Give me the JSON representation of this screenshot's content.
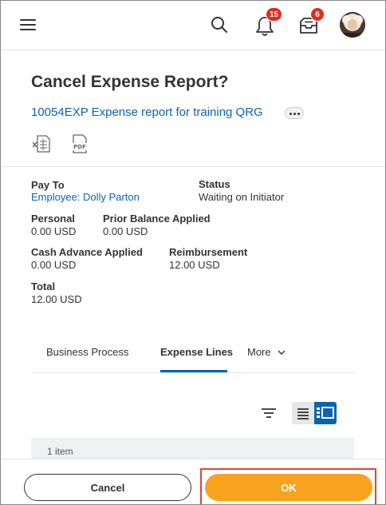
{
  "header": {
    "menu_icon": "hamburger-menu-icon",
    "search_icon": "search-icon",
    "notifications": {
      "icon": "bell-icon",
      "count": "15"
    },
    "inbox": {
      "icon": "inbox-icon",
      "count": "6"
    },
    "badge_color": "#de2e21"
  },
  "page": {
    "title": "Cancel Expense Report?",
    "report_link": "10054EXP Expense report for training QRG",
    "related_actions_icon": "ellipsis-icon",
    "export_excel_icon": "excel-export-icon",
    "export_pdf_icon": "pdf-export-icon"
  },
  "fields": {
    "pay_to": {
      "label": "Pay To",
      "value": "Employee: Dolly Parton"
    },
    "status": {
      "label": "Status",
      "value": "Waiting on Initiator"
    },
    "personal": {
      "label": "Personal",
      "value": "0.00 USD"
    },
    "prior_balance": {
      "label": "Prior Balance Applied",
      "value": "0.00 USD"
    },
    "cash_advance": {
      "label": "Cash Advance Applied",
      "value": "0.00 USD"
    },
    "reimbursement": {
      "label": "Reimbursement",
      "value": "12.00 USD"
    },
    "total": {
      "label": "Total",
      "value": "12.00 USD"
    }
  },
  "tabs": [
    {
      "label": "Business Process",
      "active": false
    },
    {
      "label": "Expense Lines",
      "active": true
    },
    {
      "label": "More",
      "active": false
    }
  ],
  "toolbar": {
    "filter_icon": "filter-icon",
    "list_view_icon": "list-view-icon",
    "card_view_icon": "card-view-icon"
  },
  "items": {
    "count_label": "1 item"
  },
  "footer": {
    "cancel_label": "Cancel",
    "ok_label": "OK",
    "ok_color": "#f9a21e",
    "highlight_color": "#e0443a"
  },
  "colors": {
    "link": "#0b64b0",
    "text": "#333333"
  }
}
